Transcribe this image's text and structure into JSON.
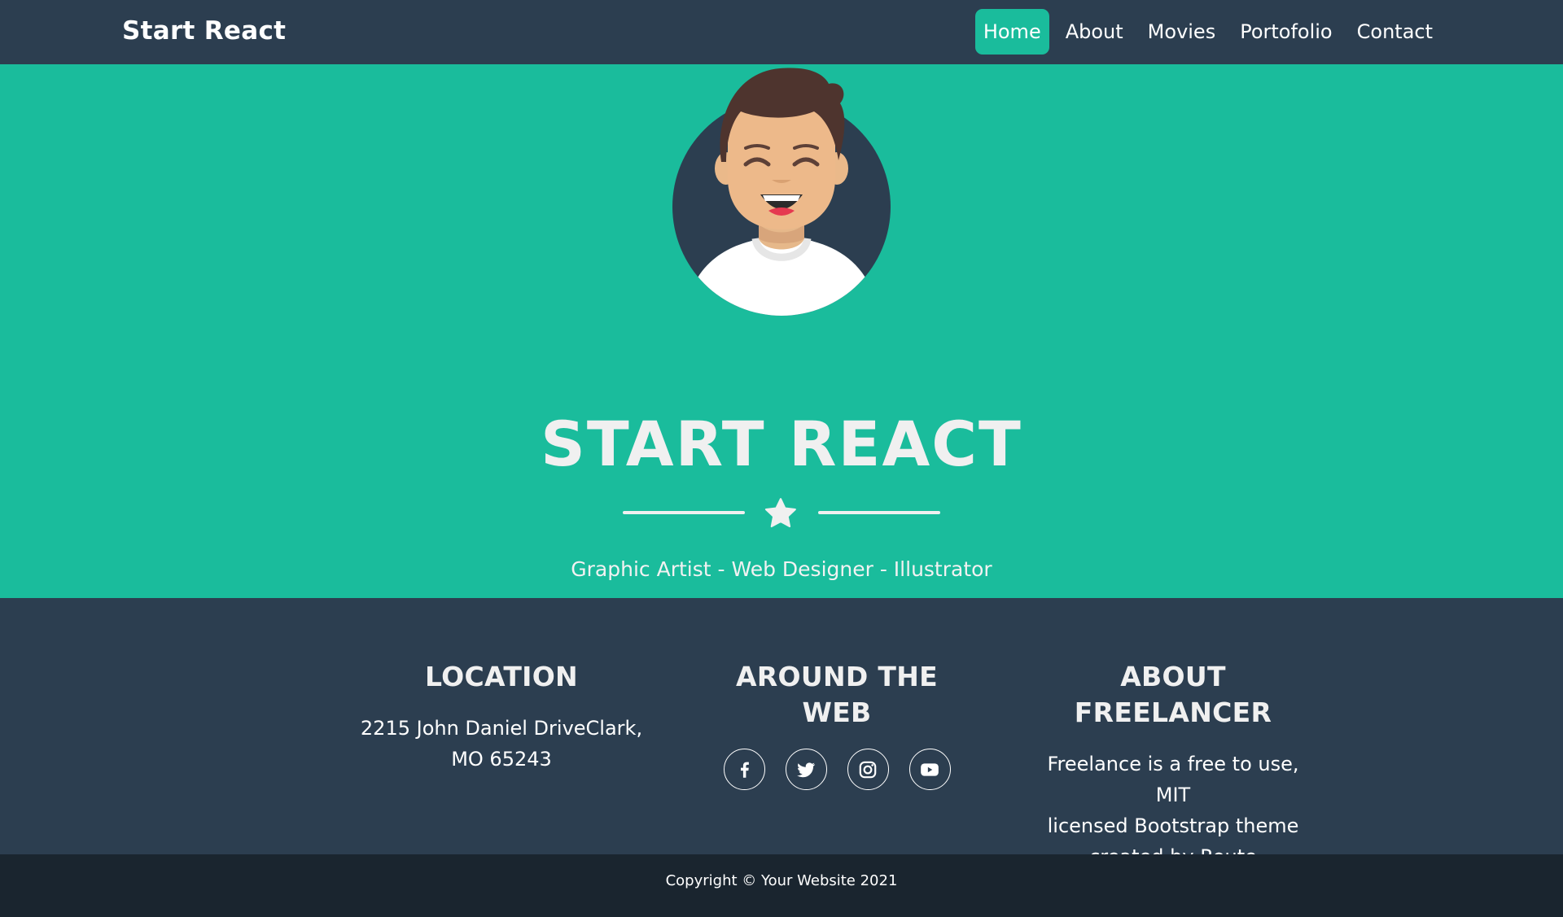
{
  "navbar": {
    "brand": "Start React",
    "links": [
      {
        "label": "Home",
        "active": true
      },
      {
        "label": "About",
        "active": false
      },
      {
        "label": "Movies",
        "active": false
      },
      {
        "label": "Portofolio",
        "active": false
      },
      {
        "label": "Contact",
        "active": false
      }
    ]
  },
  "hero": {
    "avatar_icon": "avatar-illustration",
    "title": "START REACT",
    "divider_icon": "star-icon",
    "subtitle": "Graphic Artist - Web Designer - Illustrator"
  },
  "footer": {
    "location": {
      "heading": "LOCATION",
      "line1": "2215 John Daniel DriveClark,",
      "line2": "MO 65243"
    },
    "web": {
      "heading": "AROUND THE WEB",
      "socials": [
        "facebook-icon",
        "twitter-icon",
        "instagram-icon",
        "youtube-icon"
      ]
    },
    "about": {
      "heading": "ABOUT FREELANCER",
      "line1": "Freelance is a free to use, MIT",
      "line2": "licensed Bootstrap theme",
      "line3": "created by Route"
    }
  },
  "copyright": "Copyright © Your Website 2021",
  "colors": {
    "navbar": "#2c3e50",
    "accent": "#1abc9c",
    "footer": "#2c3e50",
    "copyright_bar": "#1a252f"
  }
}
